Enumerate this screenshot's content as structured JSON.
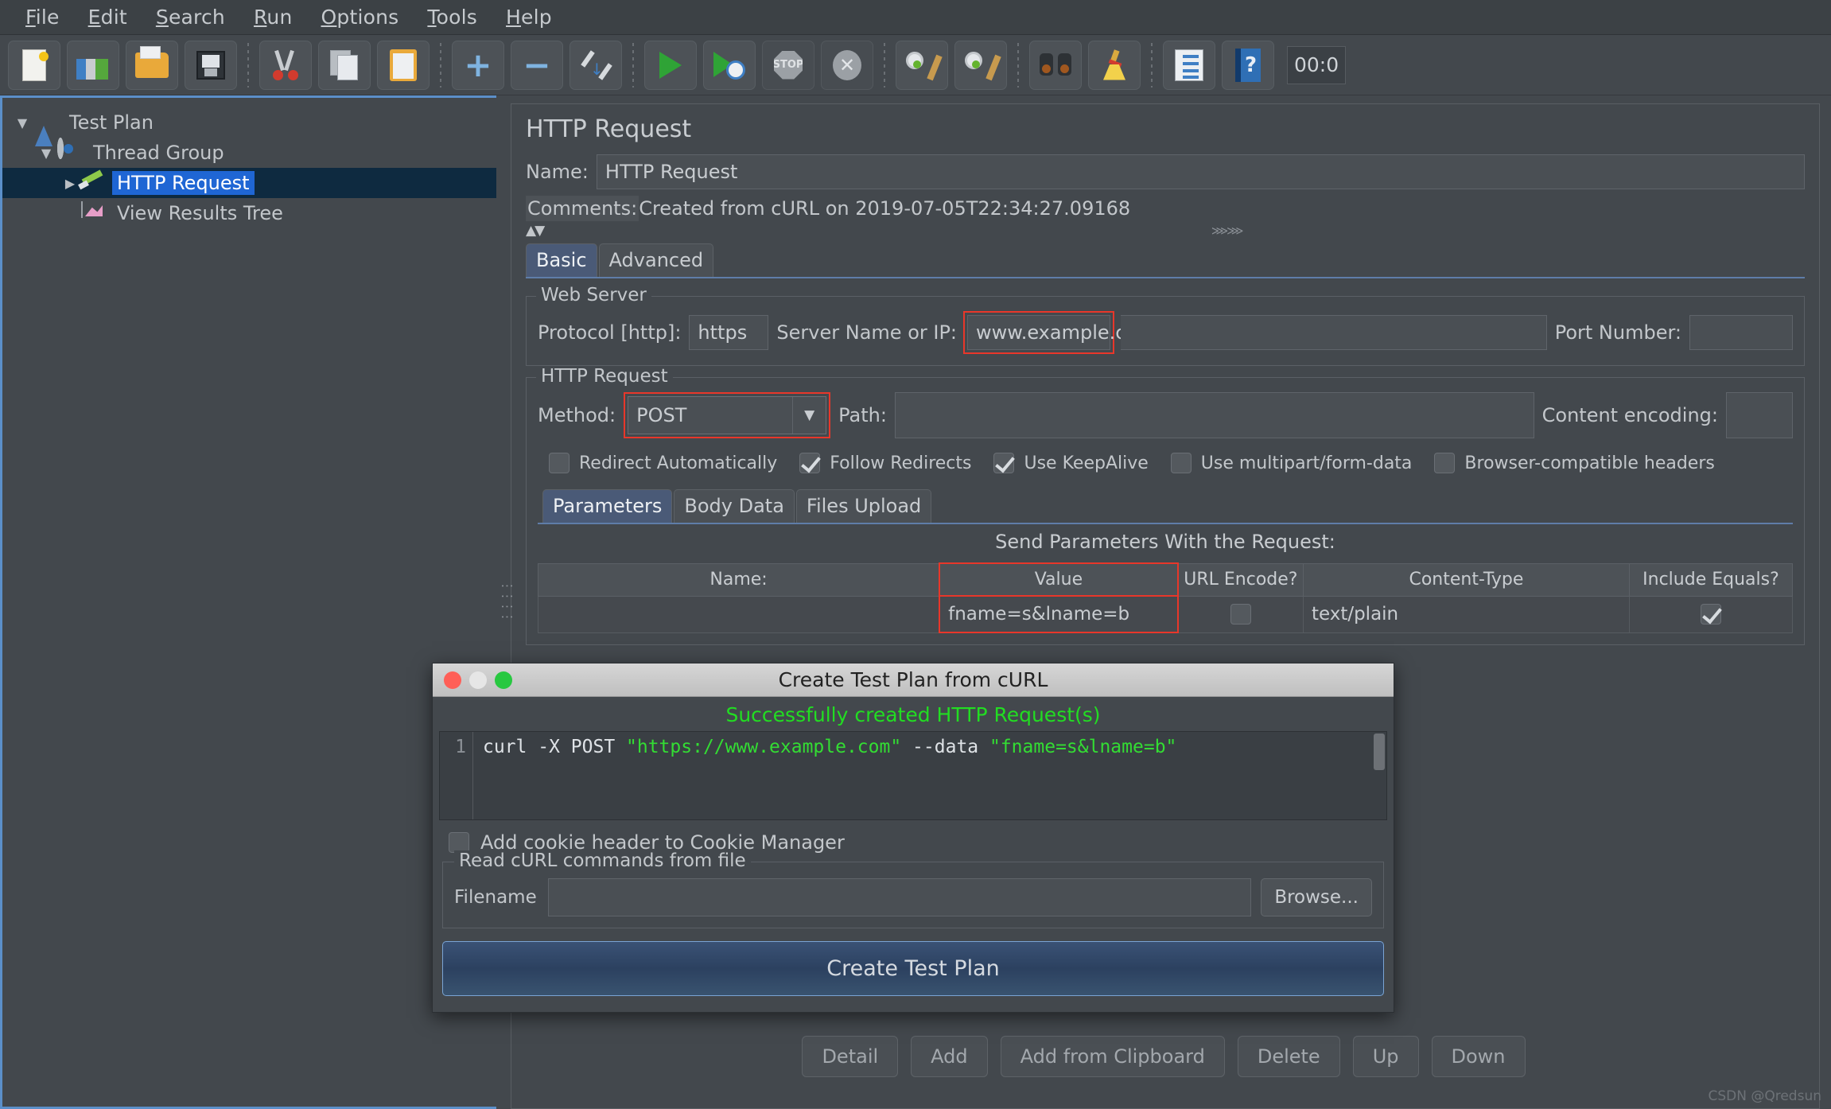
{
  "menubar": {
    "items": [
      {
        "label": "File",
        "mnemonic": "F"
      },
      {
        "label": "Edit",
        "mnemonic": "E"
      },
      {
        "label": "Search",
        "mnemonic": "S"
      },
      {
        "label": "Run",
        "mnemonic": "R"
      },
      {
        "label": "Options",
        "mnemonic": "O"
      },
      {
        "label": "Tools",
        "mnemonic": "T"
      },
      {
        "label": "Help",
        "mnemonic": "H"
      }
    ]
  },
  "toolbar": {
    "icons": [
      "new-document-icon",
      "templates-icon",
      "open-folder-icon",
      "save-icon",
      "cut-scissors-icon",
      "copy-icon",
      "paste-clipboard-icon",
      "add-plus-icon",
      "remove-minus-icon",
      "toggle-icon",
      "start-play-icon",
      "start-no-timers-icon",
      "stop-icon",
      "shutdown-icon",
      "clear-icon",
      "clear-all-icon",
      "search-binoculars-icon",
      "clear-search-broom-icon",
      "function-helper-icon",
      "help-book-icon"
    ],
    "timer": "00:0"
  },
  "tree": {
    "nodes": [
      {
        "label": "Test Plan",
        "icon": "flask-icon",
        "expanded": true,
        "indent": 0,
        "selected": false
      },
      {
        "label": "Thread Group",
        "icon": "gear-icon",
        "expanded": true,
        "indent": 1,
        "selected": false
      },
      {
        "label": "HTTP Request",
        "icon": "pen-icon",
        "expanded": false,
        "indent": 2,
        "selected": true
      },
      {
        "label": "View Results Tree",
        "icon": "chart-icon",
        "expanded": null,
        "indent": 2,
        "selected": false
      }
    ]
  },
  "request_panel": {
    "title": "HTTP Request",
    "name_label": "Name:",
    "name_value": "HTTP Request",
    "comments_label": "Comments:",
    "comments_value": "Created from cURL on 2019-07-05T22:34:27.09168",
    "tabs": [
      {
        "label": "Basic",
        "active": true
      },
      {
        "label": "Advanced",
        "active": false
      }
    ],
    "web_server": {
      "legend": "Web Server",
      "protocol_label": "Protocol [http]:",
      "protocol_value": "https",
      "server_label": "Server Name or IP:",
      "server_value": "www.example.com",
      "server_highlight_color": "#e8372a",
      "port_label": "Port Number:",
      "port_value": ""
    },
    "http_request": {
      "legend": "HTTP Request",
      "method_label": "Method:",
      "method_value": "POST",
      "method_highlight_color": "#e8372a",
      "path_label": "Path:",
      "path_value": "",
      "content_encoding_label": "Content encoding:",
      "content_encoding_value": "",
      "checkboxes": [
        {
          "label": "Redirect Automatically",
          "checked": false
        },
        {
          "label": "Follow Redirects",
          "checked": true
        },
        {
          "label": "Use KeepAlive",
          "checked": true
        },
        {
          "label": "Use multipart/form-data",
          "checked": false
        },
        {
          "label": "Browser-compatible headers",
          "checked": false
        }
      ],
      "sub_tabs": [
        {
          "label": "Parameters",
          "active": true
        },
        {
          "label": "Body Data",
          "active": false
        },
        {
          "label": "Files Upload",
          "active": false
        }
      ],
      "params_caption": "Send Parameters With the Request:",
      "params_columns": [
        "Name:",
        "Value",
        "URL Encode?",
        "Content-Type",
        "Include Equals?"
      ],
      "params_rows": [
        {
          "name": "",
          "value": "fname=s&lname=b",
          "value_highlight_color": "#e8372a",
          "url_encode": false,
          "content_type": "text/plain",
          "include_equals": true
        }
      ]
    },
    "bottom_buttons": [
      "Detail",
      "Add",
      "Add from Clipboard",
      "Delete",
      "Up",
      "Down"
    ]
  },
  "dialog": {
    "title": "Create Test Plan from cURL",
    "status_message": "Successfully created HTTP Request(s)",
    "status_color": "#22dd22",
    "code": {
      "line_number": "1",
      "prefix": "curl -X POST ",
      "url": "\"https://www.example.com\"",
      "mid": " --data ",
      "data": "\"fname=s&lname=b\""
    },
    "cookie_checkbox": {
      "label": "Add cookie header to Cookie Manager",
      "checked": false
    },
    "file_group": {
      "legend": "Read cURL commands from file",
      "filename_label": "Filename",
      "filename_value": "",
      "browse_label": "Browse..."
    },
    "create_button": "Create Test Plan"
  },
  "watermark": "CSDN @Qredsun"
}
